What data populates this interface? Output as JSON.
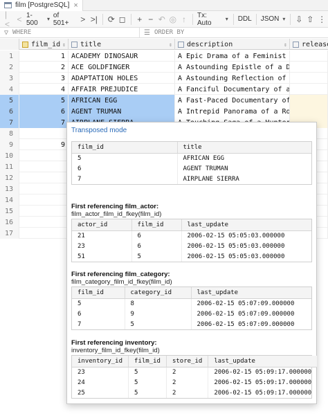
{
  "tab": {
    "label": "film [PostgreSQL]"
  },
  "toolbar": {
    "page_range": "1-500",
    "of_total": "of 501+",
    "tx_mode": "Tx: Auto",
    "ddl": "DDL",
    "json": "JSON"
  },
  "filter": {
    "where": "WHERE",
    "order_by": "ORDER BY"
  },
  "columns": {
    "film_id": "film_id",
    "title": "title",
    "description": "description",
    "release": "release"
  },
  "rows": [
    {
      "n": "1",
      "id": "1",
      "title": "ACADEMY DINOSAUR",
      "desc": "A Epic Drama of a Feminist An…"
    },
    {
      "n": "2",
      "id": "2",
      "title": "ACE GOLDFINGER",
      "desc": "A Astounding Epistle of a Dat…"
    },
    {
      "n": "3",
      "id": "3",
      "title": "ADAPTATION HOLES",
      "desc": "A Astounding Reflection of a …"
    },
    {
      "n": "4",
      "id": "4",
      "title": "AFFAIR PREJUDICE",
      "desc": "A Fanciful Documentary of a F…"
    },
    {
      "n": "5",
      "id": "5",
      "title": "AFRICAN EGG",
      "desc": "A Fast-Paced Documentary of a…"
    },
    {
      "n": "6",
      "id": "6",
      "title": "AGENT TRUMAN",
      "desc": "A Intrepid Panorama of a Robo…"
    },
    {
      "n": "7",
      "id": "7",
      "title": "AIRPLANE SIERRA",
      "desc": "A Touching Saga of a Hunter A…"
    },
    {
      "n": "8",
      "id": "",
      "title": "",
      "desc": ""
    },
    {
      "n": "9",
      "id": "9",
      "title": "",
      "desc": ""
    },
    {
      "n": "10",
      "id": "",
      "title": "",
      "desc": ""
    },
    {
      "n": "11",
      "id": "",
      "title": "",
      "desc": ""
    },
    {
      "n": "12",
      "id": "",
      "title": "",
      "desc": ""
    },
    {
      "n": "13",
      "id": "",
      "title": "",
      "desc": ""
    },
    {
      "n": "14",
      "id": "",
      "title": "",
      "desc": ""
    },
    {
      "n": "15",
      "id": "",
      "title": "",
      "desc": ""
    },
    {
      "n": "16",
      "id": "",
      "title": "",
      "desc": ""
    },
    {
      "n": "17",
      "id": "",
      "title": "",
      "desc": ""
    }
  ],
  "popup": {
    "mode_link": "Transposed mode",
    "main": {
      "headers": [
        "film_id",
        "title"
      ],
      "rows": [
        [
          "5",
          "AFRICAN EGG"
        ],
        [
          "6",
          "AGENT TRUMAN"
        ],
        [
          "7",
          "AIRPLANE SIERRA"
        ]
      ]
    },
    "actor": {
      "title": "First referencing film_actor:",
      "sub": "film_actor_film_id_fkey(film_id)",
      "headers": [
        "actor_id",
        "film_id",
        "last_update"
      ],
      "rows": [
        [
          "21",
          "6",
          "2006-02-15 05:05:03.000000"
        ],
        [
          "23",
          "6",
          "2006-02-15 05:05:03.000000"
        ],
        [
          "51",
          "5",
          "2006-02-15 05:05:03.000000"
        ]
      ]
    },
    "category": {
      "title": "First referencing film_category:",
      "sub": "film_category_film_id_fkey(film_id)",
      "headers": [
        "film_id",
        "category_id",
        "last_update"
      ],
      "rows": [
        [
          "5",
          "8",
          "2006-02-15 05:07:09.000000"
        ],
        [
          "6",
          "9",
          "2006-02-15 05:07:09.000000"
        ],
        [
          "7",
          "5",
          "2006-02-15 05:07:09.000000"
        ]
      ]
    },
    "inventory": {
      "title": "First referencing inventory:",
      "sub": "inventory_film_id_fkey(film_id)",
      "headers": [
        "inventory_id",
        "film_id",
        "store_id",
        "last_update"
      ],
      "rows": [
        [
          "23",
          "5",
          "2",
          "2006-02-15 05:09:17.000000"
        ],
        [
          "24",
          "5",
          "2",
          "2006-02-15 05:09:17.000000"
        ],
        [
          "25",
          "5",
          "2",
          "2006-02-15 05:09:17.000000"
        ]
      ]
    }
  }
}
